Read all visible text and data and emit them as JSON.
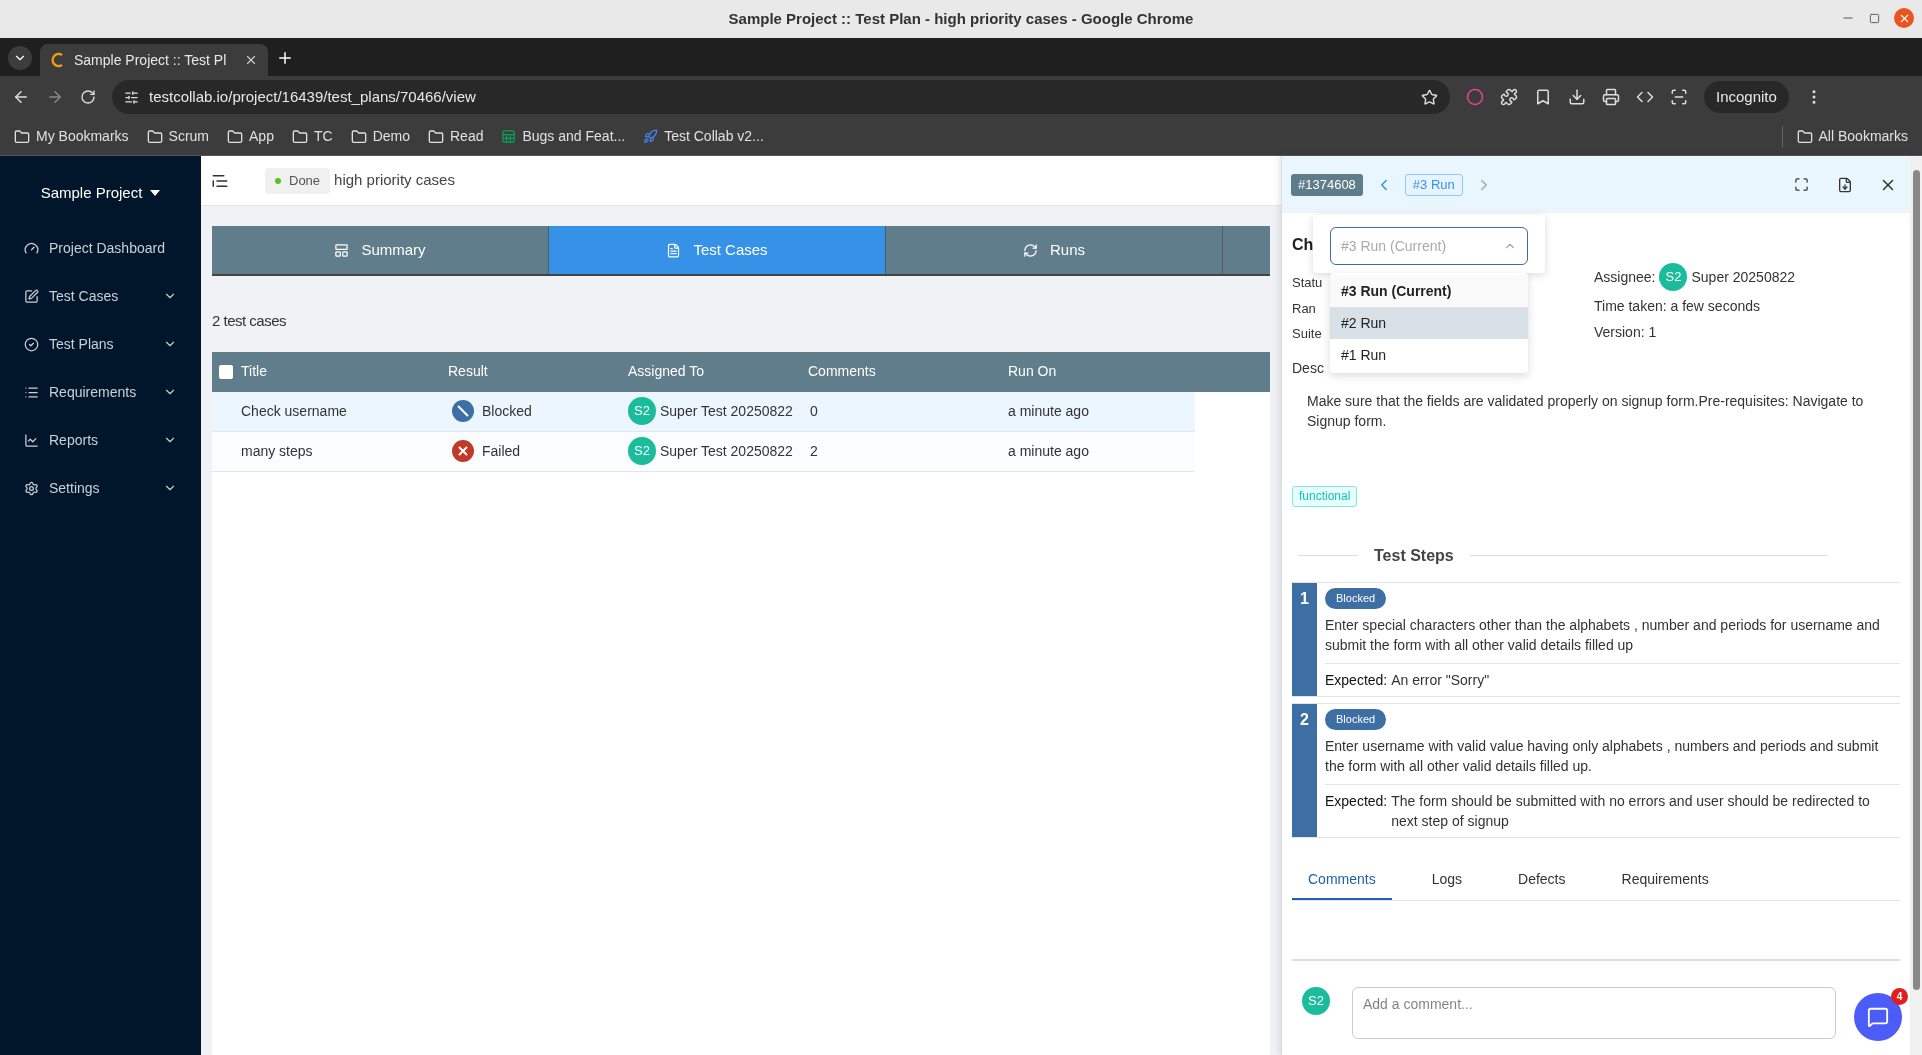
{
  "browser": {
    "window_title": "Sample Project :: Test Plan - high priority cases - Google Chrome",
    "tab_title": "Sample Project :: Test Pl",
    "url": "testcollab.io/project/16439/test_plans/70466/view",
    "profile": "Incognito",
    "all_bookmarks": "All Bookmarks",
    "bookmarks": [
      {
        "label": "My Bookmarks",
        "kind": "folder"
      },
      {
        "label": "Scrum",
        "kind": "folder"
      },
      {
        "label": "App",
        "kind": "folder"
      },
      {
        "label": "TC",
        "kind": "folder"
      },
      {
        "label": "Demo",
        "kind": "folder"
      },
      {
        "label": "Read",
        "kind": "folder"
      },
      {
        "label": "Bugs and Feat...",
        "kind": "sheet"
      },
      {
        "label": "Test Collab v2...",
        "kind": "app"
      }
    ]
  },
  "sidebar": {
    "project": "Sample Project",
    "items": [
      {
        "label": "Project Dashboard",
        "kind": "dashboard",
        "expandable": false
      },
      {
        "label": "Test Cases",
        "kind": "edit",
        "expandable": true
      },
      {
        "label": "Test Plans",
        "kind": "check",
        "expandable": true
      },
      {
        "label": "Requirements",
        "kind": "list",
        "expandable": true
      },
      {
        "label": "Reports",
        "kind": "chart",
        "expandable": true
      },
      {
        "label": "Settings",
        "kind": "gear",
        "expandable": true
      }
    ]
  },
  "plan": {
    "status": "Done",
    "title": "high priority cases"
  },
  "tabs": [
    {
      "label": "Summary",
      "kind": "summary",
      "selected": false
    },
    {
      "label": "Test Cases",
      "kind": "cases",
      "selected": true
    },
    {
      "label": "Runs",
      "kind": "runs",
      "selected": false
    }
  ],
  "count": "2 test cases",
  "table": {
    "select_all": {
      "checked": false
    },
    "columns": [
      "Title",
      "Result",
      "Assigned To",
      "Comments",
      "Run On"
    ],
    "rows": [
      {
        "title": "Check username",
        "result": "Blocked",
        "kind": "blocked",
        "initials": "S2",
        "assignee": "Super Test 20250822",
        "comments": "0",
        "run_on": "a minute ago",
        "selected": true
      },
      {
        "title": "many steps",
        "result": "Failed",
        "kind": "failed",
        "initials": "S2",
        "assignee": "Super Test 20250822",
        "comments": "2",
        "run_on": "a minute ago",
        "selected": false
      }
    ]
  },
  "panel": {
    "case_id": "#1374608",
    "run_badge": "#3 Run",
    "title": "Ch",
    "left_fields": [
      "Statu",
      "Ran",
      "Suite"
    ],
    "assignee_label": "Assignee:",
    "assignee_initials": "S2",
    "assignee": "Super 20250822",
    "time_taken": "Time taken: a few seconds",
    "version": "Version: 1",
    "description_label": "Desc",
    "description": "Make sure that the fields are validated properly on signup form.Pre-requisites: Navigate to Signup form.",
    "tags": [
      "functional"
    ],
    "steps_heading": "Test Steps",
    "steps": [
      {
        "number": "1",
        "status": "Blocked",
        "text": "Enter special characters other than the alphabets , number and periods for username and submit the form with all other valid details filled up",
        "expected_label": "Expected:",
        "expected": "An error \"Sorry\""
      },
      {
        "number": "2",
        "status": "Blocked",
        "text": "Enter username with valid value having only alphabets , numbers and periods and submit the form with all other valid details filled up.",
        "expected_label": "Expected:",
        "expected": "The form should be submitted with no errors and user should be redirected to next step of signup"
      }
    ],
    "tabs": [
      {
        "label": "Comments",
        "selected": true
      },
      {
        "label": "Logs",
        "selected": false
      },
      {
        "label": "Defects",
        "selected": false
      },
      {
        "label": "Requirements",
        "selected": false
      }
    ],
    "comment": {
      "initials": "S2",
      "placeholder": "Add a comment..."
    },
    "chat_badge": "4",
    "run_select": {
      "placeholder": "#3 Run (Current)",
      "expanded": true,
      "options": [
        {
          "label": "#3 Run (Current)",
          "selected": true,
          "highlighted": false
        },
        {
          "label": "#2 Run",
          "selected": false,
          "highlighted": true
        },
        {
          "label": "#1 Run",
          "selected": false,
          "highlighted": false
        }
      ]
    }
  }
}
